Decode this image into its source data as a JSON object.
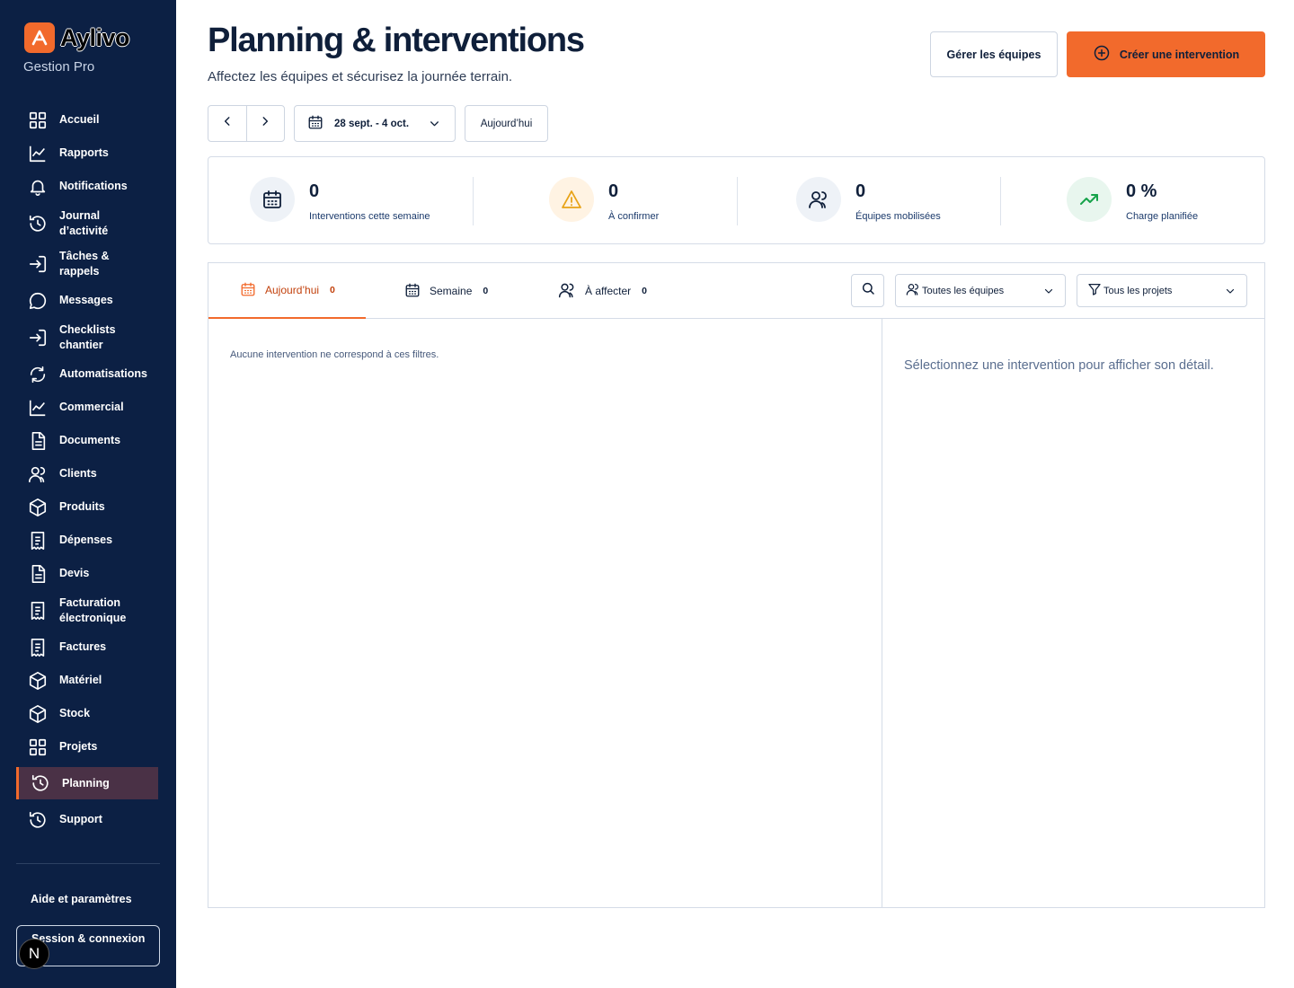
{
  "brand": {
    "name": "Aylivo",
    "subtitle": "Gestion Pro"
  },
  "sidebar": {
    "items": [
      {
        "label": "Accueil",
        "icon": "grid-icon"
      },
      {
        "label": "Rapports",
        "icon": "chart-line-icon"
      },
      {
        "label": "Notifications",
        "icon": "bell-icon"
      },
      {
        "label": "Journal d’activité",
        "icon": "history-icon"
      },
      {
        "label": "Tâches & rappels",
        "icon": "login-icon"
      },
      {
        "label": "Messages",
        "icon": "message-icon"
      },
      {
        "label": "Checklists chantier",
        "icon": "login-icon"
      },
      {
        "label": "Automatisations",
        "icon": "refresh-icon"
      },
      {
        "label": "Commercial",
        "icon": "chart-line-icon"
      },
      {
        "label": "Documents",
        "icon": "document-icon"
      },
      {
        "label": "Clients",
        "icon": "users-icon"
      },
      {
        "label": "Produits",
        "icon": "box-icon"
      },
      {
        "label": "Dépenses",
        "icon": "receipt-icon"
      },
      {
        "label": "Devis",
        "icon": "document-icon"
      },
      {
        "label": "Facturation électronique",
        "icon": "receipt-icon"
      },
      {
        "label": "Factures",
        "icon": "receipt-icon"
      },
      {
        "label": "Matériel",
        "icon": "box-icon"
      },
      {
        "label": "Stock",
        "icon": "box-icon"
      },
      {
        "label": "Projets",
        "icon": "grid-icon"
      },
      {
        "label": "Planning",
        "icon": "history-icon",
        "active": true
      },
      {
        "label": "Support",
        "icon": "history-icon"
      }
    ],
    "help_label": "Aide et paramètres",
    "session_label": "Session & connexion",
    "badge_letter": "N"
  },
  "header": {
    "title": "Planning & interventions",
    "subtitle": "Affectez les équipes et sécurisez la journée terrain.",
    "manage_teams_label": "Gérer les équipes",
    "create_label": "Créer une intervention"
  },
  "date_controls": {
    "range_label": "28 sept. - 4 oct.",
    "today_label": "Aujourd’hui"
  },
  "stats": [
    {
      "value": "0",
      "caption": "Interventions cette semaine",
      "icon": "calendar-icon"
    },
    {
      "value": "0",
      "caption": "À confirmer",
      "icon": "warning-icon"
    },
    {
      "value": "0",
      "caption": "Équipes mobilisées",
      "icon": "users-icon"
    },
    {
      "value": "0 %",
      "caption": "Charge planifiée",
      "icon": "trend-up-icon"
    }
  ],
  "tabs": [
    {
      "label": "Aujourd’hui",
      "count": "0",
      "active": true
    },
    {
      "label": "Semaine",
      "count": "0"
    },
    {
      "label": "À affecter",
      "count": "0"
    }
  ],
  "filters": {
    "teams_value": "Toutes les équipes",
    "projects_value": "Tous les projets"
  },
  "list": {
    "empty_message": "Aucune intervention ne correspond à ces filtres."
  },
  "detail": {
    "placeholder": "Sélectionnez une intervention pour afficher son détail."
  },
  "colors": {
    "sidebar": "#0c2044",
    "accent": "#f26a2c",
    "active_item": "#4a3146"
  }
}
